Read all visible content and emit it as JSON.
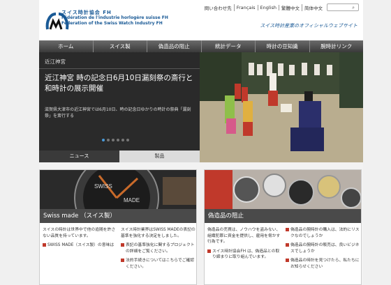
{
  "header": {
    "brand_jp": "スイス時計協会 FH",
    "brand_fr": "Fédération de l'industrie horlogère suisse FH",
    "brand_en": "Federation of the Swiss Watch Industry FH",
    "links": [
      "問い合わせ先",
      "Français",
      "English",
      "繁體中文",
      "简体中文"
    ],
    "tagline": "スイス時計産業のオフィシャルウェブサイト"
  },
  "nav": [
    "ホーム",
    "スイス製",
    "偽造品の阻止",
    "統計データ",
    "時計の豆知識",
    "腕時計リンク"
  ],
  "hero": {
    "category": "近江神宮",
    "title": "近江神宮 時の記念日6月10日漏刻祭の斎行と和時計の展示開催",
    "description": "滋賀県大津市の近江神宮では6月10日、時の記念日ゆかりの時計の祭典「漏刻祭」を斎行する",
    "tabs": [
      "ニュース",
      "製品"
    ]
  },
  "panels": [
    {
      "title": "Swiss made （スイス製）",
      "image_text": [
        "SWISS",
        "MADE"
      ],
      "col1_text": "スイスの時計は世界中で他の追随を許さない品質を持っています。",
      "col1_items": [
        "SWISS MADE（スイス製）の意味は"
      ],
      "col2_text": "スイス時計業界はSWISS MADEの表記の基準を強化する決定をしました。",
      "col2_items": [
        "表記の基準強化に関するプロジェクトの詳細をご覧ください。",
        "法的手続きについてはこちらでご確認ください。"
      ]
    },
    {
      "title": "偽造品の阻止",
      "col1_text": "偽造品の売買は、ノウハウを盗みない、組織犯罪に資金を提供し、雇用を脅かす行為です。",
      "col1_items": [
        "スイス時計協会FH は、偽造品との取り締まりに取り組んでいます。"
      ],
      "col2_items": [
        "偽造品の腕時計の購入は、法的にリスクなのでしょうか",
        "偽造品の腕時計の販売は、良いビジネスでしょうか",
        "偽造品の時計を見つけたら、私たちにお知らせください"
      ]
    }
  ],
  "colors": {
    "brand_blue": "#1a5a96",
    "nav_dark": "#3a3a3a",
    "bullet_red": "#c0392b",
    "active_dot": "#4a9ad8"
  }
}
